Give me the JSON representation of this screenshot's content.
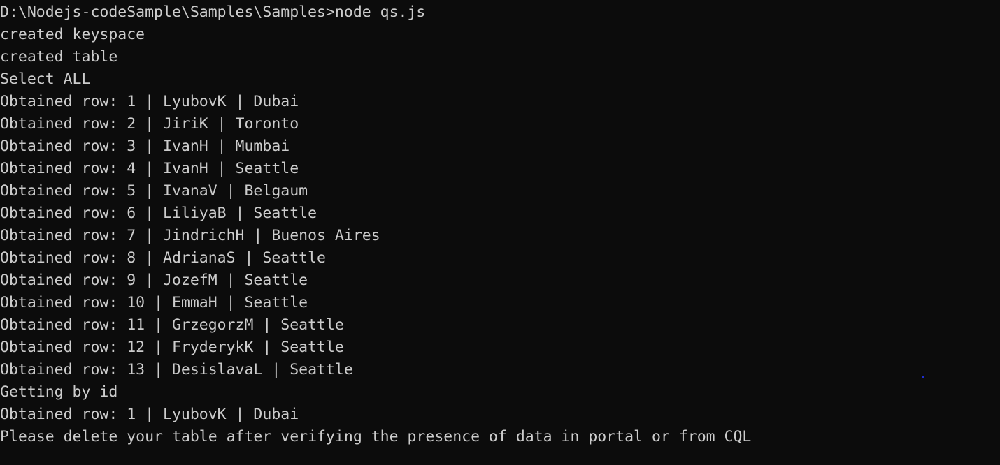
{
  "terminal": {
    "background_color": "#0c0c0c",
    "foreground_color": "#cccccc",
    "prompt_line": "D:\\Nodejs-codeSample\\Samples\\Samples>node qs.js",
    "status_lines": {
      "created_keyspace": "created keyspace",
      "created_table": "created table",
      "select_all": "Select ALL",
      "getting_by_id": "Getting by id",
      "closing_note": "Please delete your table after verifying the presence of data in portal or from CQL"
    },
    "row_prefix": "Obtained row: ",
    "separator": " | ",
    "select_all_rows": [
      {
        "id": "1",
        "name": "LyubovK",
        "city": "Dubai"
      },
      {
        "id": "2",
        "name": "JiriK",
        "city": "Toronto"
      },
      {
        "id": "3",
        "name": "IvanH",
        "city": "Mumbai"
      },
      {
        "id": "4",
        "name": "IvanH",
        "city": "Seattle"
      },
      {
        "id": "5",
        "name": "IvanaV",
        "city": "Belgaum"
      },
      {
        "id": "6",
        "name": "LiliyaB",
        "city": "Seattle"
      },
      {
        "id": "7",
        "name": "JindrichH",
        "city": "Buenos Aires"
      },
      {
        "id": "8",
        "name": "AdrianaS",
        "city": "Seattle"
      },
      {
        "id": "9",
        "name": "JozefM",
        "city": "Seattle"
      },
      {
        "id": "10",
        "name": "EmmaH",
        "city": "Seattle"
      },
      {
        "id": "11",
        "name": "GrzegorzM",
        "city": "Seattle"
      },
      {
        "id": "12",
        "name": "FryderykK",
        "city": "Seattle"
      },
      {
        "id": "13",
        "name": "DesislavaL",
        "city": "Seattle"
      }
    ],
    "get_by_id_rows": [
      {
        "id": "1",
        "name": "LyubovK",
        "city": "Dubai"
      }
    ],
    "lines": [
      "D:\\Nodejs-codeSample\\Samples\\Samples>node qs.js",
      "created keyspace",
      "created table",
      "Select ALL",
      "Obtained row: 1 | LyubovK | Dubai",
      "Obtained row: 2 | JiriK | Toronto",
      "Obtained row: 3 | IvanH | Mumbai",
      "Obtained row: 4 | IvanH | Seattle",
      "Obtained row: 5 | IvanaV | Belgaum",
      "Obtained row: 6 | LiliyaB | Seattle",
      "Obtained row: 7 | JindrichH | Buenos Aires",
      "Obtained row: 8 | AdrianaS | Seattle",
      "Obtained row: 9 | JozefM | Seattle",
      "Obtained row: 10 | EmmaH | Seattle",
      "Obtained row: 11 | GrzegorzM | Seattle",
      "Obtained row: 12 | FryderykK | Seattle",
      "Obtained row: 13 | DesislavaL | Seattle",
      "Getting by id",
      "Obtained row: 1 | LyubovK | Dubai",
      "Please delete your table after verifying the presence of data in portal or from CQL"
    ]
  }
}
